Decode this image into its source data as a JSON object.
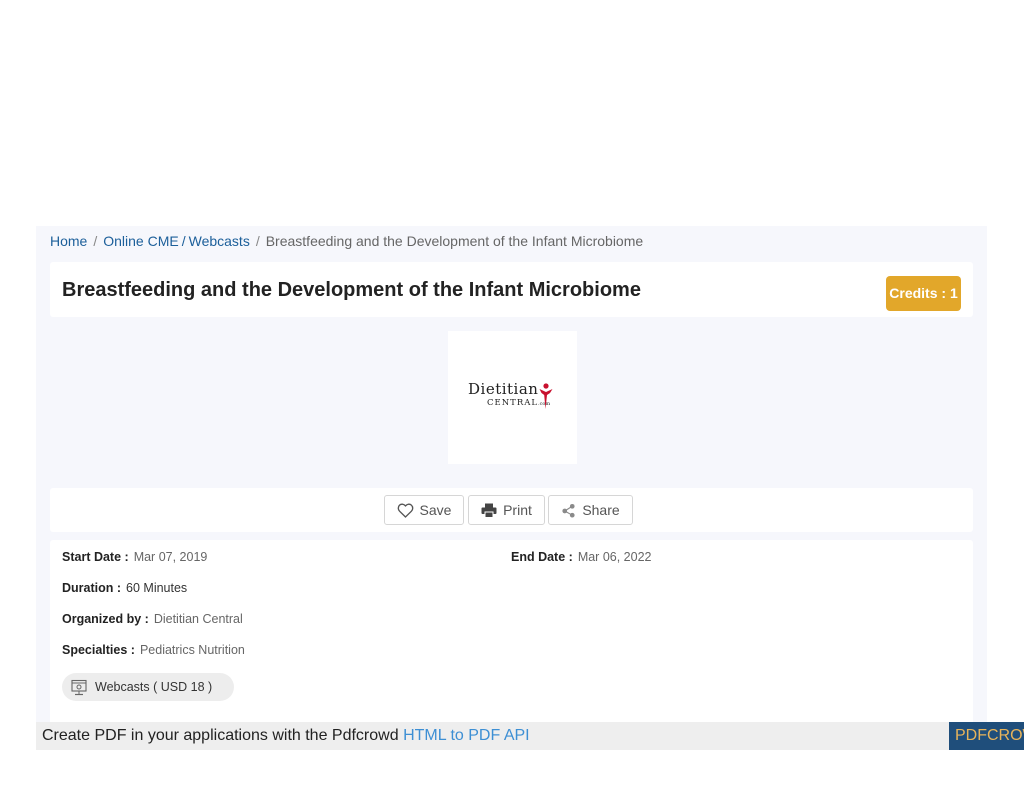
{
  "breadcrumb": {
    "home": "Home",
    "online_cme": "Online CME",
    "webcasts": "Webcasts",
    "current": "Breastfeeding and the Development of the Infant Microbiome"
  },
  "course": {
    "title": "Breastfeeding and the Development of the Infant Microbiome",
    "credits_label": "Credits : 1"
  },
  "logo": {
    "name": "Dietitian",
    "sub": "CENTRAL",
    "com": ".com",
    "accent_color": "#c8102e"
  },
  "actions": {
    "save": "Save",
    "print": "Print",
    "share": "Share"
  },
  "details": {
    "start_date_label": "Start Date :",
    "start_date": "Mar 07, 2019",
    "end_date_label": "End Date :",
    "end_date": "Mar 06, 2022",
    "duration_label": "Duration :",
    "duration": "60 Minutes",
    "organized_label": "Organized by :",
    "organized": "Dietitian Central",
    "specialties_label": "Specialties :",
    "specialties": "Pediatrics Nutrition",
    "chip": "Webcasts ( USD 18 )"
  },
  "pdf_banner": {
    "text": "Create PDF in your applications with the Pdfcrowd",
    "link": "HTML to PDF API",
    "brand": "PDFCROWD"
  },
  "colors": {
    "link": "#1c5f9a",
    "badge": "#e2a72a",
    "panel": "#f6f7fc",
    "banner_brand": "#1f4e7b"
  }
}
